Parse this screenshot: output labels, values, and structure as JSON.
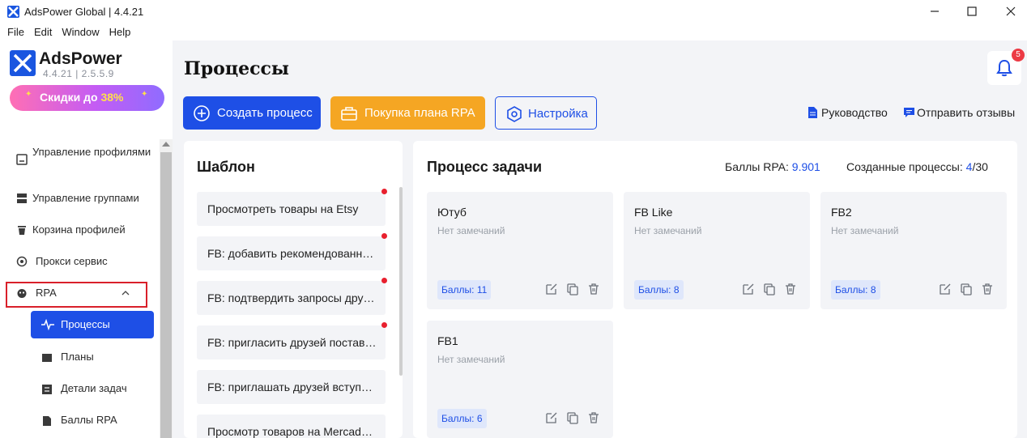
{
  "window": {
    "title": "AdsPower Global | 4.4.21"
  },
  "menu": [
    "File",
    "Edit",
    "Window",
    "Help"
  ],
  "sidebar": {
    "brand": "AdsPower",
    "version": "4.4.21  |  2.5.5.9",
    "promo_text": "Скидки до ",
    "promo_percent": "38%",
    "items": [
      {
        "label": "Управление профилями",
        "icon": "profile-icon"
      },
      {
        "label": "Управление группами",
        "icon": "group-icon"
      },
      {
        "label": "Корзина профилей",
        "icon": "trash-icon"
      },
      {
        "label": "Прокси сервис",
        "icon": "proxy-icon"
      },
      {
        "label": "RPA",
        "icon": "rpa-icon",
        "expanded": true
      }
    ],
    "rpa_subitems": [
      {
        "label": "Процессы",
        "icon": "pulse-icon",
        "active": true
      },
      {
        "label": "Планы",
        "icon": "plan-icon"
      },
      {
        "label": "Детали задач",
        "icon": "task-detail-icon"
      },
      {
        "label": "Баллы RPA",
        "icon": "points-icon"
      }
    ]
  },
  "main": {
    "title": "Процессы",
    "notification_count": "5",
    "buttons": {
      "create": "Создать процесс",
      "buy": "Покупка плана RPA",
      "settings": "Настройка"
    },
    "links": {
      "guide": "Руководство",
      "feedback": "Отправить отзывы"
    },
    "template_panel": {
      "title": "Шаблон",
      "items": [
        {
          "text": "Просмотреть товары на Etsy",
          "dot": true
        },
        {
          "text": "FB: добавить рекомендованных друзей",
          "dot": true
        },
        {
          "text": "FB: подтвердить запросы друзей",
          "dot": true
        },
        {
          "text": "FB: пригласить друзей поставить лайк",
          "dot": true
        },
        {
          "text": "FB: приглашать друзей вступить в группу",
          "dot": false
        },
        {
          "text": "Просмотр товаров на Mercado Libre",
          "dot": false
        }
      ]
    },
    "tasks_panel": {
      "title": "Процесс задачи",
      "rpa_points_label": "Баллы RPA:",
      "rpa_points_value": "9.901",
      "created_label": "Созданные процессы:",
      "created_value": "4",
      "created_separator": "/",
      "created_max": "30",
      "cards": [
        {
          "name": "Ютуб",
          "note": "Нет замечаний",
          "score": "Баллы: 11"
        },
        {
          "name": "FB Like",
          "note": "Нет замечаний",
          "score": "Баллы: 8"
        },
        {
          "name": "FB2",
          "note": "Нет замечаний",
          "score": "Баллы: 8"
        },
        {
          "name": "FB1",
          "note": "Нет замечаний",
          "score": "Баллы: 6"
        }
      ]
    }
  },
  "colors": {
    "primary": "#1e4fe6",
    "buy": "#f5a623",
    "highlight_box": "#d9202a",
    "badge": "#ec3a44",
    "panel_bg": "#f3f4f7"
  }
}
